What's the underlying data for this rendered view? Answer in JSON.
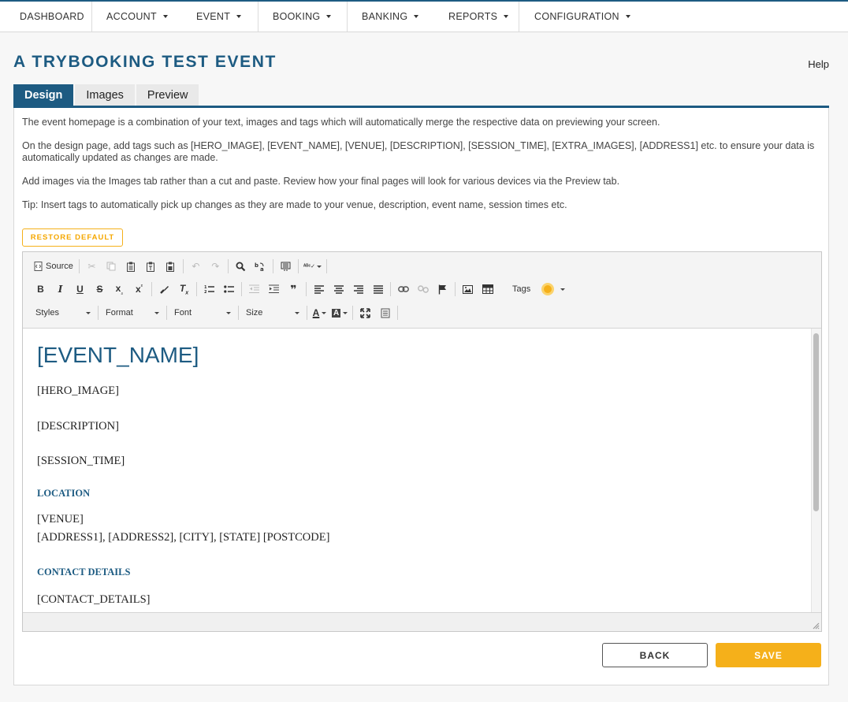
{
  "nav": {
    "items": [
      {
        "label": "DASHBOARD",
        "dropdown": false
      },
      {
        "label": "ACCOUNT",
        "dropdown": true
      },
      {
        "label": "EVENT",
        "dropdown": true
      },
      {
        "label": "BOOKING",
        "dropdown": true
      },
      {
        "label": "BANKING",
        "dropdown": true
      },
      {
        "label": "REPORTS",
        "dropdown": true
      },
      {
        "label": "CONFIGURATION",
        "dropdown": true
      }
    ]
  },
  "page": {
    "title": "A TRYBOOKING TEST EVENT",
    "help": "Help"
  },
  "tabs": [
    {
      "label": "Design",
      "active": true
    },
    {
      "label": "Images",
      "active": false
    },
    {
      "label": "Preview",
      "active": false
    }
  ],
  "intro": {
    "p1": "The event homepage is a combination of your text, images and tags which will automatically merge the respective data on previewing your screen.",
    "p2": "On the design page, add tags such as [HERO_IMAGE], [EVENT_NAME], [VENUE], [DESCRIPTION], [SESSION_TIME], [EXTRA_IMAGES], [ADDRESS1] etc. to ensure your data is automatically updated as changes are made.",
    "p3": "Add images via the Images tab rather than a cut and paste. Review how your final pages will look for various devices via the Preview tab.",
    "p4": "Tip: Insert tags to automatically pick up changes as they are made to your venue, description, event name, session times etc."
  },
  "restore_label": "RESTORE DEFAULT",
  "toolbar": {
    "source_label": "Source",
    "tags_label": "Tags",
    "styles_label": "Styles",
    "format_label": "Format",
    "font_label": "Font",
    "size_label": "Size"
  },
  "content": {
    "event_name": "[EVENT_NAME]",
    "hero_image": "[HERO_IMAGE]",
    "description": "[DESCRIPTION]",
    "session_time": "[SESSION_TIME]",
    "location_heading": "LOCATION",
    "venue": "[VENUE]",
    "address": "[ADDRESS1], [ADDRESS2], [CITY], [STATE] [POSTCODE]",
    "contact_heading": "CONTACT DETAILS",
    "contact_details": "[CONTACT_DETAILS]"
  },
  "buttons": {
    "back": "BACK",
    "save": "SAVE"
  },
  "colors": {
    "brand_blue": "#1d5b82",
    "accent_yellow": "#f5b01a"
  }
}
